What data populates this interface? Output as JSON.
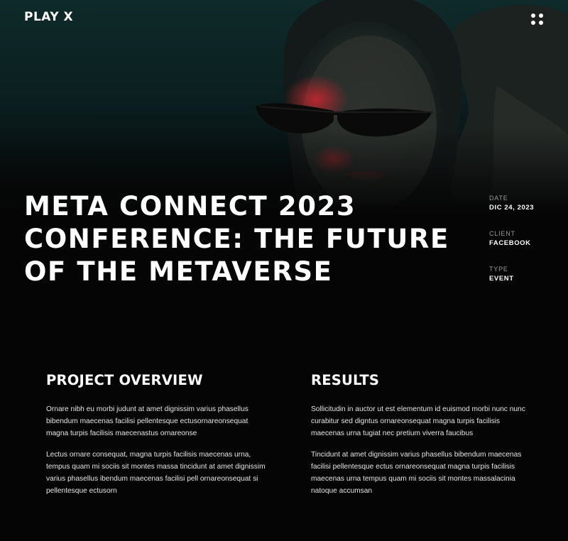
{
  "header": {
    "logo": "PLAY X",
    "menu_icon": "grid-dots-icon"
  },
  "hero": {
    "image": "hero-photo-woman-sunglasses",
    "title": "META CONNECT 2023 CONFERENCE: THE FUTURE OF THE METAVERSE"
  },
  "meta": [
    {
      "label": "DATE",
      "value": "DIC 24, 2023"
    },
    {
      "label": "CLIENT",
      "value": "FACEBOOK"
    },
    {
      "label": "TYPE",
      "value": "EVENT"
    }
  ],
  "overview": {
    "heading": "PROJECT OVERVIEW",
    "paragraphs": [
      "Ornare nibh eu morbi judunt at amet dignissim varius phasellus bibendum maecenas facilisi pellentesque ectusornareonsequat magna turpis facilisis maecenastus ornareonse",
      "Lectus ornare consequat, magna turpis facilisis maecenas urna, tempus quam mi sociis sit montes massa tincidunt at amet dignissim varius phasellus ibendum maecenas facilisi pell ornareonsequat si pellentesque ectusorn"
    ]
  },
  "results": {
    "heading": "RESULTS",
    "paragraphs": [
      "Sollicitudin in auctor ut est elementum id euismod morbi nunc nunc curabitur sed digntus ornareonsequat magna turpis facilisis maecenas urna tugiat nec pretium viverra faucibus",
      "Tincidunt at amet dignissim varius phasellus bibendum maecenas facilisi pellentesque ectus ornareonsequat magna turpis facilisis maecenas urna tempus quam mi sociis sit montes massalacinia natoque accumsan"
    ]
  },
  "colors": {
    "background": "#050505",
    "hero_teal": "#0f2a2a",
    "text": "#ffffff",
    "muted": "#9a9a9a",
    "accent_red": "#c4232b"
  }
}
